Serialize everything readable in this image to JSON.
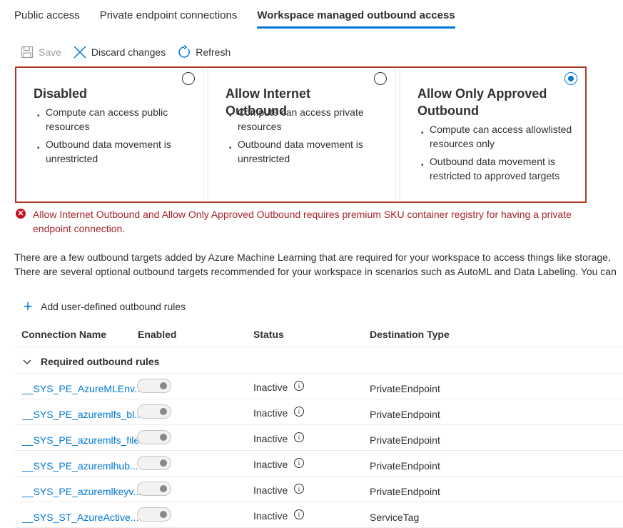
{
  "tabs": [
    {
      "label": "Public access",
      "active": false
    },
    {
      "label": "Private endpoint connections",
      "active": false
    },
    {
      "label": "Workspace managed outbound access",
      "active": true
    }
  ],
  "toolbar": {
    "save_label": "Save",
    "discard_label": "Discard changes",
    "refresh_label": "Refresh"
  },
  "modes": [
    {
      "title": "Disabled",
      "selected": false,
      "bullets": [
        "Compute can access public resources",
        "Outbound data movement is unrestricted"
      ]
    },
    {
      "title": "Allow Internet Outbound",
      "selected": false,
      "bullets": [
        "Compute can access private resources",
        "Outbound data movement is unrestricted"
      ]
    },
    {
      "title": "Allow Only Approved Outbound",
      "selected": true,
      "bullets": [
        "Compute can access allowlisted resources only",
        "Outbound data movement is restricted to approved targets"
      ]
    }
  ],
  "error_message": "Allow Internet Outbound and Allow Only Approved Outbound requires premium SKU container registry for having a private endpoint connection.",
  "info_lines": [
    "There are a few outbound targets added by Azure Machine Learning that are required for your workspace to access things like storage,",
    "There are several optional outbound targets recommended for your workspace in scenarios such as AutoML and Data Labeling. You can"
  ],
  "add_rule_label": "Add user-defined outbound rules",
  "columns": {
    "name": "Connection Name",
    "enabled": "Enabled",
    "status": "Status",
    "destination": "Destination Type"
  },
  "group_title": "Required outbound rules",
  "rules": [
    {
      "name": "__SYS_PE_AzureMLEnv...",
      "enabled": false,
      "status": "Inactive",
      "destination": "PrivateEndpoint"
    },
    {
      "name": "__SYS_PE_azuremlfs_bl...",
      "enabled": false,
      "status": "Inactive",
      "destination": "PrivateEndpoint"
    },
    {
      "name": "__SYS_PE_azuremlfs_file",
      "enabled": false,
      "status": "Inactive",
      "destination": "PrivateEndpoint"
    },
    {
      "name": "__SYS_PE_azuremlhub...",
      "enabled": false,
      "status": "Inactive",
      "destination": "PrivateEndpoint"
    },
    {
      "name": "__SYS_PE_azuremlkeyv...",
      "enabled": false,
      "status": "Inactive",
      "destination": "PrivateEndpoint"
    },
    {
      "name": "__SYS_ST_AzureActive...",
      "enabled": false,
      "status": "Inactive",
      "destination": "ServiceTag"
    }
  ],
  "icons": {
    "save": "save-icon",
    "discard": "close-icon",
    "refresh": "refresh-icon",
    "error": "error-icon",
    "add": "plus-icon",
    "chevron": "chevron-down-icon",
    "info": "info-icon"
  },
  "colors": {
    "accent": "#0078d4",
    "error": "#a4262c",
    "error_border": "#b83c2b"
  }
}
